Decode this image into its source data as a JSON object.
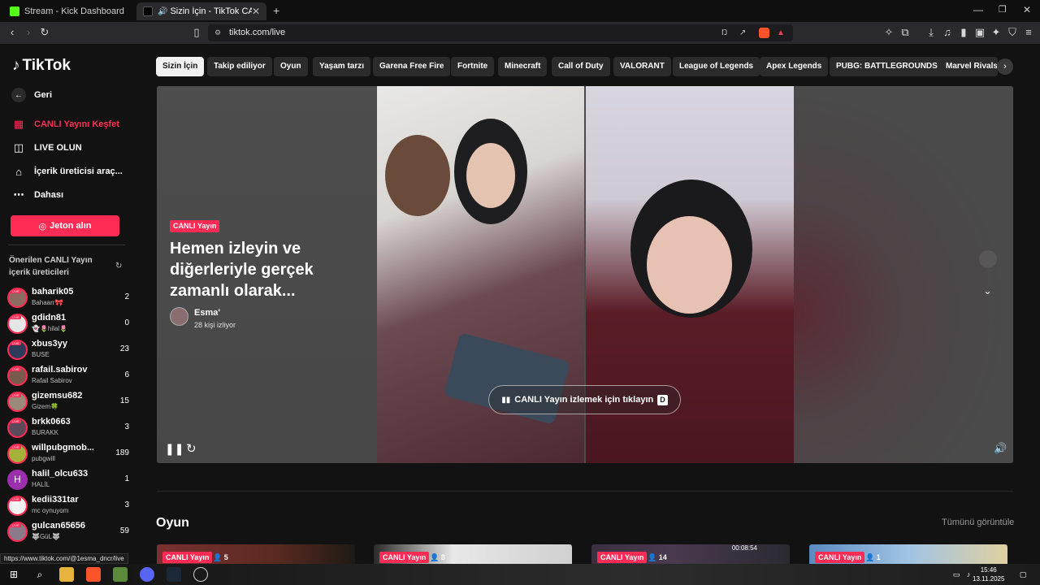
{
  "browser": {
    "tabs": [
      {
        "title": "Stream - Kick Dashboard"
      },
      {
        "title": "Sizin İçin - TikTok CANLI Yayı"
      }
    ],
    "new_tab": "+",
    "url": "tiktok.com/live",
    "status_url": "https://www.tiktok.com/@1esma_dncr/live"
  },
  "sidebar": {
    "logo": "TikTok",
    "back": "Geri",
    "nav": [
      {
        "label": "CANLI Yayını Keşfet"
      },
      {
        "label": "LIVE OLUN"
      },
      {
        "label": "İçerik üreticisi araç..."
      },
      {
        "label": "Dahası"
      }
    ],
    "jeton_label": "Jeton alın",
    "suggested_title": "Önerilen CANLI Yayın içerik üreticileri",
    "creators": [
      {
        "name": "baharik05",
        "sub": "Bahaarr🎀",
        "count": "2"
      },
      {
        "name": "gdidn81",
        "sub": "👻🌷hilal🌷",
        "count": "0"
      },
      {
        "name": "xbus3yy",
        "sub": "BUSE",
        "count": "23"
      },
      {
        "name": "rafail.sabirov",
        "sub": "Rafail Sabirov",
        "count": "6"
      },
      {
        "name": "gizemsu682",
        "sub": "Gizem🍀",
        "count": "15"
      },
      {
        "name": "brkk0663",
        "sub": "BURAKK",
        "count": "3"
      },
      {
        "name": "willpubgmob...",
        "sub": "pubgwill",
        "count": "189"
      },
      {
        "name": "halil_olcu633",
        "sub": "HALİL",
        "count": "1"
      },
      {
        "name": "kedii331tar",
        "sub": "mc oynuyom",
        "count": "3"
      },
      {
        "name": "gulcan65656",
        "sub": "🐺GüL🐺",
        "count": "59"
      }
    ]
  },
  "categories": [
    "Sizin İçin",
    "Takip ediliyor",
    "Oyun",
    "Yaşam tarzı",
    "Garena Free Fire",
    "Fortnite",
    "Minecraft",
    "Call of Duty",
    "VALORANT",
    "League of Legends",
    "Apex Legends",
    "PUBG: BATTLEGROUNDS",
    "Marvel Rivals"
  ],
  "hero": {
    "badge": "CANLI Yayın",
    "title": "Hemen izleyin ve diğerleriyle gerçek zamanlı olarak...",
    "host": "Esma'",
    "viewers": "28 kişi izliyor",
    "watch_label": "CANLI Yayın izlemek için tıklayın",
    "watch_key": "D"
  },
  "section": {
    "title": "Oyun",
    "see_all": "Tümünü görüntüle",
    "cards": [
      {
        "badge": "CANLI Yayın",
        "viewers": "5",
        "time": ""
      },
      {
        "badge": "CANLI Yayın",
        "viewers": "8",
        "time": ""
      },
      {
        "badge": "CANLI Yayın",
        "viewers": "14",
        "time": "00:08:54"
      },
      {
        "badge": "CANLI Yayın",
        "viewers": "1",
        "time": ""
      }
    ]
  },
  "taskbar": {
    "time": "15:46",
    "date": "13.11.2025"
  },
  "colors": {
    "accent": "#fe2c55",
    "background": "#121212",
    "chip": "#2b2b2b"
  }
}
